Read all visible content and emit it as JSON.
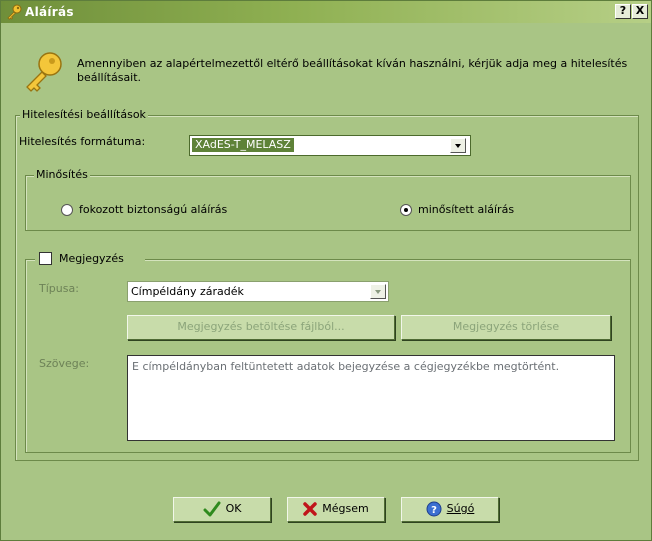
{
  "window": {
    "title": "Aláírás"
  },
  "intro": {
    "text": "Amennyiben az alapértelmezettől eltérő beállításokat kíván használni, kérjük adja meg a hitelesítés beállításait."
  },
  "auth_settings": {
    "legend": "Hitelesítési beállítások",
    "format_label": "Hitelesítés formátuma:",
    "format_value": "XAdES-T_MELASZ"
  },
  "qualification": {
    "legend": "Minősítés",
    "options": [
      {
        "label": "fokozott biztonságú aláírás",
        "checked": false
      },
      {
        "label": "minősített aláírás",
        "checked": true
      }
    ]
  },
  "note": {
    "legend": "Megjegyzés",
    "checked": false,
    "type_label": "Típusa:",
    "type_value": "Címpéldány záradék",
    "load_button": "Megjegyzés betöltése fájlból...",
    "delete_button": "Megjegyzés törlése",
    "text_label": "Szövege:",
    "text_value": "E címpéldányban feltüntetett adatok bejegyzése a cégjegyzékbe megtörtént."
  },
  "buttons": {
    "ok": "OK",
    "cancel": "Mégsem",
    "help": "Súgó"
  },
  "titlebar_buttons": {
    "help": "?",
    "close": "X"
  }
}
